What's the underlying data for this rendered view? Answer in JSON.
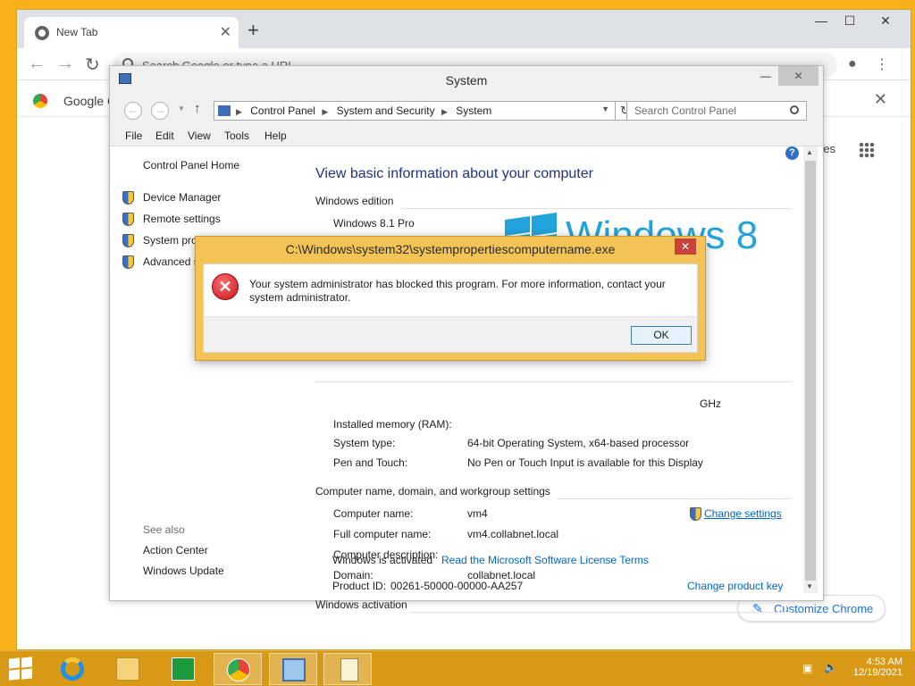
{
  "browser": {
    "tab_title": "New Tab",
    "tab_close": "✕",
    "new_tab": "+",
    "omnibox_placeholder": "Search Google or type a URL",
    "bookmark_label": "Google C",
    "ntp_link": "es",
    "customize_label": "Customize Chrome",
    "window_controls": {
      "minimize": "—",
      "maximize": "☐",
      "close": "✕"
    }
  },
  "system_window": {
    "title": "System",
    "breadcrumbs": [
      "Control Panel",
      "System and Security",
      "System"
    ],
    "search_placeholder": "Search Control Panel",
    "menu": [
      "File",
      "Edit",
      "View",
      "Tools",
      "Help"
    ],
    "left_nav": {
      "home": "Control Panel Home",
      "items": [
        "Device Manager",
        "Remote settings",
        "System pro",
        "Advanced s"
      ],
      "see_also_heading": "See also",
      "see_also": [
        "Action Center",
        "Windows Update"
      ]
    },
    "heading": "View basic information about your computer",
    "windows_edition": {
      "section": "Windows edition",
      "edition": "Windows 8.1 Pro",
      "logo_text": "Windows 8"
    },
    "system": {
      "processor_tail": "GHz",
      "installed_memory_label": "Installed memory (RAM):",
      "system_type_label": "System type:",
      "system_type": "64-bit Operating System, x64-based processor",
      "pen_touch_label": "Pen and Touch:",
      "pen_touch": "No Pen or Touch Input is available for this Display"
    },
    "computer_name": {
      "section": "Computer name, domain, and workgroup settings",
      "computer_name_label": "Computer name:",
      "computer_name": "vm4",
      "full_name_label": "Full computer name:",
      "full_name": "vm4.collabnet.local",
      "description_label": "Computer description:",
      "description": "",
      "domain_label": "Domain:",
      "domain": "collabnet.local",
      "change_settings": "Change settings"
    },
    "activation": {
      "section": "Windows activation",
      "status": "Windows is activated",
      "license_link": "Read the Microsoft Software License Terms",
      "product_id_label": "Product ID:",
      "product_id": "00261-50000-00000-AA257",
      "change_key": "Change product key"
    }
  },
  "error_dialog": {
    "title": "C:\\Windows\\system32\\systempropertiescomputername.exe",
    "message": "Your system administrator has blocked this program. For more information, contact your system administrator.",
    "ok_label": "OK",
    "close": "✕"
  },
  "taskbar": {
    "time": "4:53 AM",
    "date": "12/19/2021"
  },
  "colors": {
    "desktop": "#f7b21a",
    "taskbar": "#d89a16",
    "link": "#0066cc",
    "heading": "#1e3287",
    "windows_blue": "#22a3dc",
    "error_red": "#c3161c"
  }
}
